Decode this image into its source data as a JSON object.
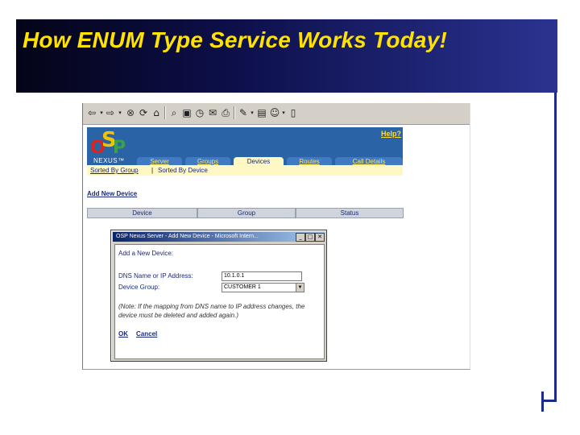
{
  "slide": {
    "title": "How ENUM Type Service Works Today!"
  },
  "browser_toolbar": {
    "icons": [
      "back-icon",
      "forward-icon",
      "stop-icon",
      "refresh-icon",
      "home-icon",
      "search-icon",
      "favorites-icon",
      "history-icon",
      "mail-icon",
      "print-icon",
      "edit-icon",
      "discuss-icon",
      "messenger-icon"
    ]
  },
  "app": {
    "logo": {
      "o": "O",
      "s": "S",
      "p": "P"
    },
    "brand": "NEXUS™",
    "help": "Help?",
    "tabs": [
      {
        "label": "Server",
        "active": false
      },
      {
        "label": "Groups",
        "active": false
      },
      {
        "label": "Devices",
        "active": true
      },
      {
        "label": "Routes",
        "active": false
      },
      {
        "label": "Call Details",
        "active": false
      }
    ],
    "subnav": {
      "sorted_by_group": "Sorted By Group",
      "separator": "|",
      "sorted_by_device": "Sorted By Device"
    },
    "add_new_device": "Add New Device",
    "columns": [
      "Device",
      "Group",
      "Status"
    ]
  },
  "dialog": {
    "title": "OSP Nexus Server - Add New Device - Microsoft Intern...",
    "heading": "Add a New Device:",
    "dns_label": "DNS Name or IP Address:",
    "dns_value": "10.1.0.1",
    "group_label": "Device Group:",
    "group_value": "CUSTOMER 1",
    "note": "(Note: If the mapping from DNS name to IP address changes, the device must be deleted and added again.)",
    "ok": "OK",
    "cancel": "Cancel"
  }
}
